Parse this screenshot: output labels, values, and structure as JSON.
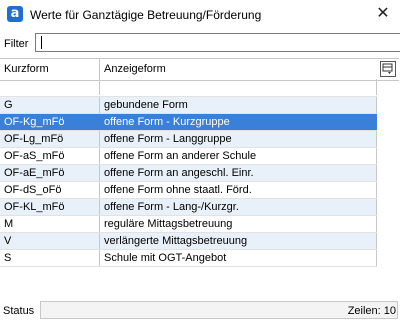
{
  "window": {
    "title": "Werte für Ganztägige Betreuung/Förderung",
    "app_icon": "a",
    "close_symbol": "✕"
  },
  "filter": {
    "label": "Filter",
    "value": ""
  },
  "table": {
    "columns": [
      "Kurzform",
      "Anzeigeform"
    ],
    "header_button_icon": "column-chooser-icon",
    "rows": [
      {
        "kurzform": "G",
        "anzeigeform": "gebundene Form"
      },
      {
        "kurzform": "OF-Kg_mFö",
        "anzeigeform": "offene Form - Kurzgruppe"
      },
      {
        "kurzform": "OF-Lg_mFö",
        "anzeigeform": "offene Form - Langgruppe"
      },
      {
        "kurzform": "OF-aS_mFö",
        "anzeigeform": "offene Form an anderer Schule"
      },
      {
        "kurzform": "OF-aE_mFö",
        "anzeigeform": "offene Form an angeschl. Einr."
      },
      {
        "kurzform": "OF-dS_oFö",
        "anzeigeform": "offene Form ohne staatl. Förd."
      },
      {
        "kurzform": "OF-KL_mFö",
        "anzeigeform": "offene Form - Lang-/Kurzgr."
      },
      {
        "kurzform": "M",
        "anzeigeform": "reguläre Mittagsbetreuung"
      },
      {
        "kurzform": "V",
        "anzeigeform": "verlängerte Mittagsbetreuung"
      },
      {
        "kurzform": "S",
        "anzeigeform": "Schule mit OGT-Angebot"
      }
    ],
    "selected_index": 1
  },
  "status": {
    "label": "Status",
    "row_count": "Zeilen: 10"
  },
  "colors": {
    "selection": "#3a7fd8",
    "alt_row": "#e8f0f9",
    "app_icon": "#1f6fd1"
  }
}
